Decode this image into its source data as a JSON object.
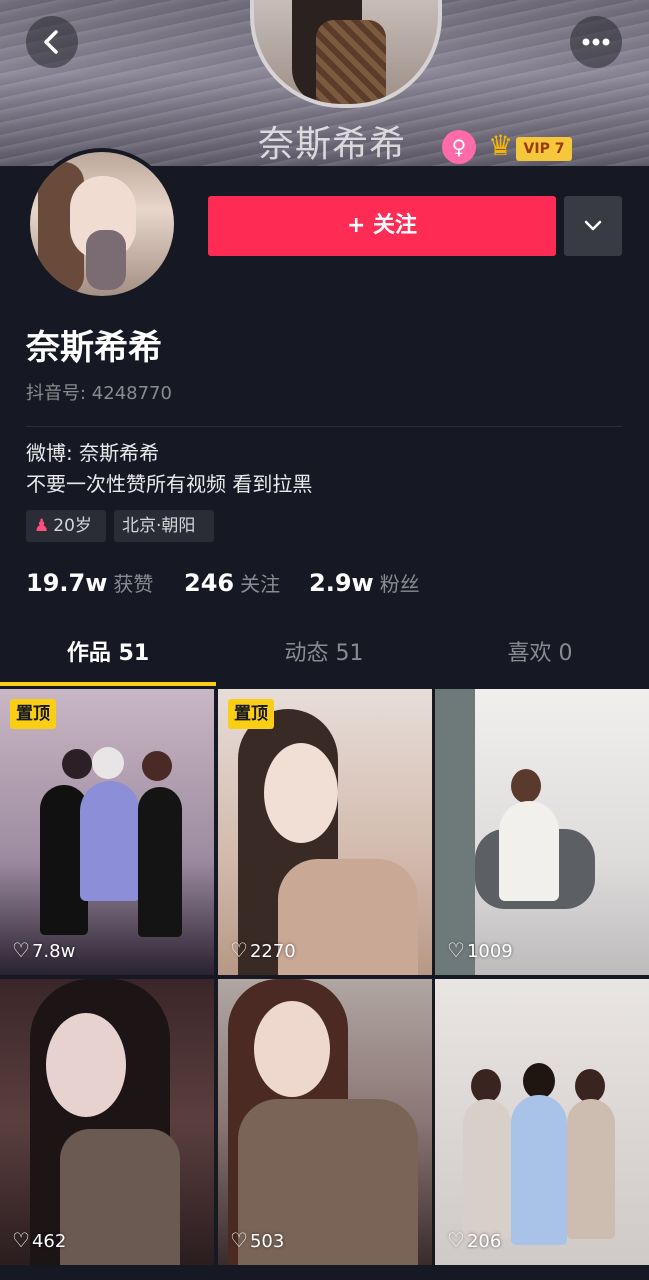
{
  "header": {
    "cover_name": "奈斯希希",
    "vip_label": "VIP 7",
    "back_icon": "chevron-left-icon",
    "more_icon": "more-dots-icon",
    "gender_icon": "female-icon"
  },
  "profile": {
    "name": "奈斯希希",
    "douyin_id": "抖音号: 4248770",
    "follow_label": "+ 关注",
    "bio": [
      "微博: 奈斯希希",
      "不要一次性赞所有视频 看到拉黑"
    ],
    "tags": {
      "age": "20岁",
      "location": "北京·朝阳"
    },
    "stats": [
      {
        "value": "19.7w",
        "label": "获赞"
      },
      {
        "value": "246",
        "label": "关注"
      },
      {
        "value": "2.9w",
        "label": "粉丝"
      }
    ]
  },
  "tabs": [
    {
      "label": "作品 51",
      "active": true
    },
    {
      "label": "动态 51",
      "active": false
    },
    {
      "label": "喜欢 0",
      "active": false
    }
  ],
  "videos": [
    {
      "pinned": "置顶",
      "likes": "7.8w"
    },
    {
      "pinned": "置顶",
      "likes": "2270"
    },
    {
      "pinned": "",
      "likes": "1009"
    },
    {
      "pinned": "",
      "likes": "462"
    },
    {
      "pinned": "",
      "likes": "503"
    },
    {
      "pinned": "",
      "likes": "206"
    }
  ],
  "colors": {
    "background": "#161823",
    "follow_button": "#fe2c55",
    "tab_indicator": "#face15",
    "pin_badge": "#face15"
  }
}
